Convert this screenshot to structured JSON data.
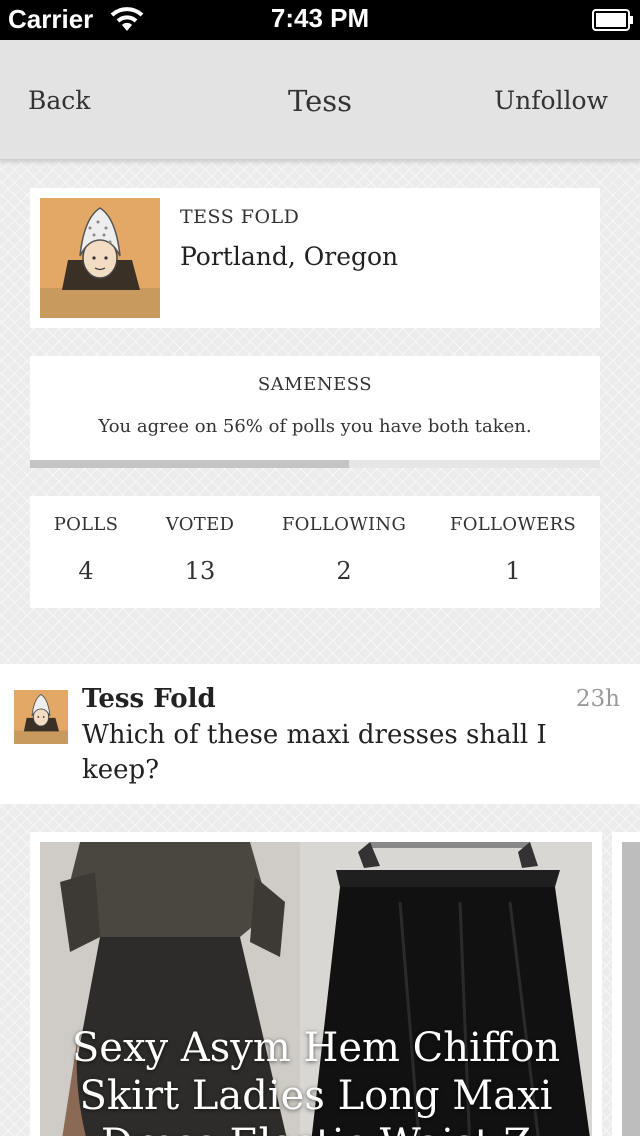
{
  "status_bar": {
    "carrier": "Carrier",
    "time": "7:43 PM"
  },
  "nav": {
    "back_label": "Back",
    "title": "Tess",
    "unfollow_label": "Unfollow"
  },
  "profile": {
    "name": "TESS FOLD",
    "location": "Portland, Oregon"
  },
  "sameness": {
    "title": "SAMENESS",
    "text": "You agree on 56% of polls you have both taken.",
    "progress": 0.56
  },
  "stats": [
    {
      "label": "POLLS",
      "value": "4"
    },
    {
      "label": "VOTED",
      "value": "13"
    },
    {
      "label": "FOLLOWING",
      "value": "2"
    },
    {
      "label": "FOLLOWERS",
      "value": "1"
    }
  ],
  "post": {
    "author": "Tess Fold",
    "time": "23h",
    "question": "Which of these maxi dresses shall I keep?"
  },
  "option": {
    "caption_lines": [
      "Sexy Asym Hem Chiffon",
      "Skirt Ladies Long Maxi",
      "Dress Elastic Waist Z"
    ]
  }
}
